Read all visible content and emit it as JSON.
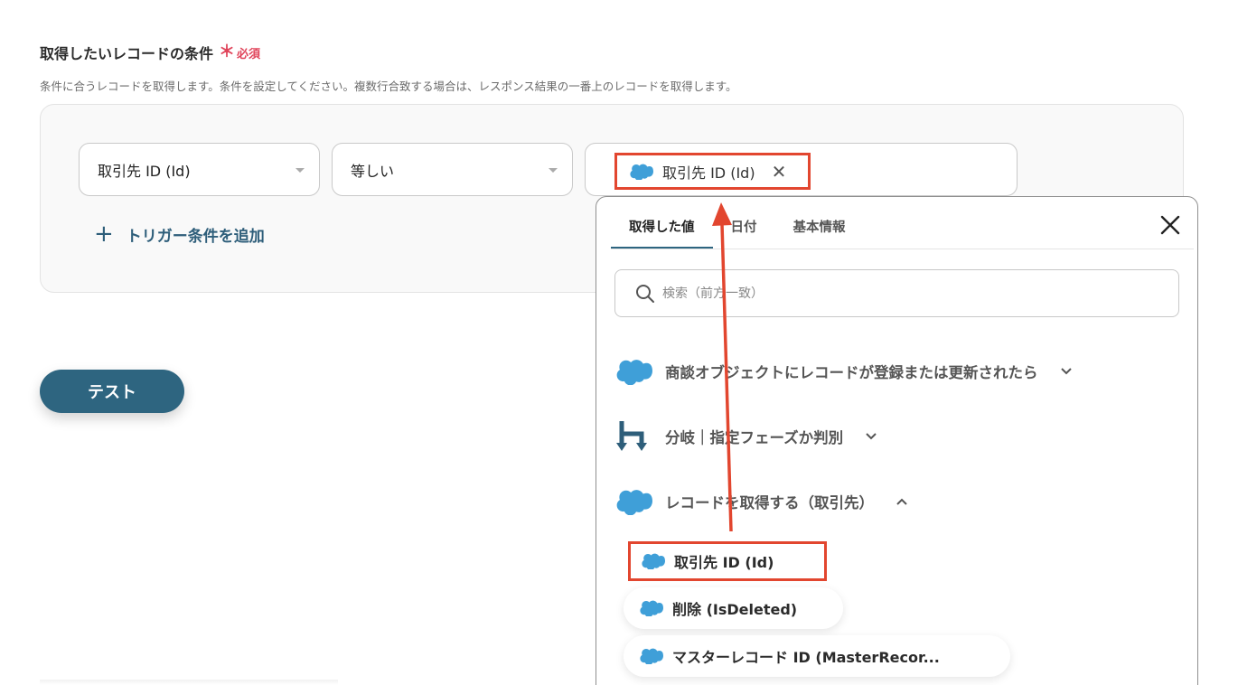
{
  "section": {
    "title": "取得したいレコードの条件",
    "required_mark": "＊",
    "required_label": "必須",
    "description": "条件に合うレコードを取得します。条件を設定してください。複数行合致する場合は、レスポンス結果の一番上のレコードを取得します。"
  },
  "condition": {
    "field_value": "取引先 ID (Id)",
    "operator_value": "等しい",
    "value_chip": "取引先 ID (Id)",
    "add_trigger_label": "トリガー条件を追加"
  },
  "test_button": "テスト",
  "dropdown": {
    "tabs": [
      "取得した値",
      "日付",
      "基本情報"
    ],
    "active_tab": "取得した値",
    "search_placeholder": "検索（前方一致）",
    "groups": [
      {
        "label": "商談オブジェクトにレコードが登録または更新されたら",
        "icon": "salesforce-cloud-icon",
        "expanded": false
      },
      {
        "label": "分岐｜指定フェーズか判別",
        "icon": "branch-icon",
        "expanded": false
      },
      {
        "label": "レコードを取得する（取引先）",
        "icon": "salesforce-cloud-icon",
        "expanded": true
      }
    ],
    "fields": [
      "取引先 ID (Id)",
      "削除 (IsDeleted)",
      "マスターレコード ID (MasterRecor..."
    ]
  },
  "colors": {
    "accent": "#2e6580",
    "highlight": "#e2462f",
    "salesforce": "#3f9fd8",
    "required": "#e0445a"
  }
}
